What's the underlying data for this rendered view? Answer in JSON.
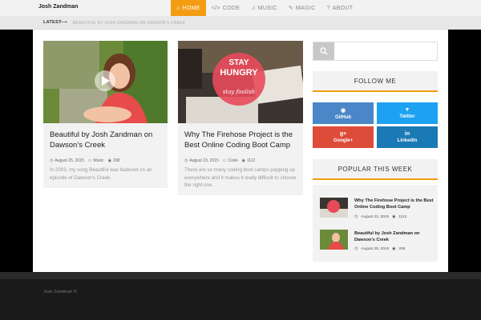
{
  "brand": "Josh Zandman",
  "nav": [
    {
      "icon": "home-icon",
      "glyph": "⌂",
      "label": "HOME",
      "active": true
    },
    {
      "icon": "code-icon",
      "glyph": "</>",
      "label": "CODE",
      "active": false
    },
    {
      "icon": "music-icon",
      "glyph": "♫",
      "label": "MUSIC",
      "active": false
    },
    {
      "icon": "magic-icon",
      "glyph": "✎",
      "label": "MAGIC",
      "active": false
    },
    {
      "icon": "question-icon",
      "glyph": "?",
      "label": "ABOUT",
      "active": false
    }
  ],
  "ticker": {
    "label": "LATEST",
    "arrow": "⟶",
    "text": "BEAUTIFUL BY JOSH ZANDMAN ON DAWSON'S CREEK"
  },
  "posts": [
    {
      "title": "Beautiful by Josh Zandman on Dawson’s Creek",
      "date": "August 25, 2015",
      "category": "Music",
      "views": "208",
      "excerpt": "In 2003, my song Beautiful was featured on an episode of Dawson's Creek."
    },
    {
      "title": "Why The Firehose Project is the Best Online Coding Boot Camp",
      "date": "August 23, 2015",
      "category": "Code",
      "views": "1112",
      "excerpt": "There are so many coding boot camps popping up everywhere and it makes it really difficult to choose the right one.",
      "image_text": {
        "line1": "STAY",
        "line2": "HUNGRY",
        "line3": "stay foolish"
      }
    }
  ],
  "sidebar": {
    "follow_title": "FOLLOW ME",
    "social": [
      {
        "name": "GitHub",
        "icon": "github-icon",
        "glyph": "◉",
        "color": "#4a86c8"
      },
      {
        "name": "Twitter",
        "icon": "twitter-icon",
        "glyph": "🐦",
        "color": "#1da1f2"
      },
      {
        "name": "Google+",
        "icon": "google-plus-icon",
        "glyph": "g+",
        "color": "#dd4b39"
      },
      {
        "name": "Linkedin",
        "icon": "linkedin-icon",
        "glyph": "in",
        "color": "#1a7ab5"
      }
    ],
    "popular_title": "POPULAR THIS WEEK",
    "popular": [
      {
        "title": "Why The Firehose Project is the Best Online Coding Boot Camp",
        "date": "August 23, 2015",
        "views": "1112"
      },
      {
        "title": "Beautiful by Josh Zandman on Dawson’s Creek",
        "date": "August 25, 2015",
        "views": "208"
      }
    ]
  },
  "footer": {
    "text": "Josh Zandman ©"
  },
  "colors": {
    "accent": "#f39c12"
  }
}
